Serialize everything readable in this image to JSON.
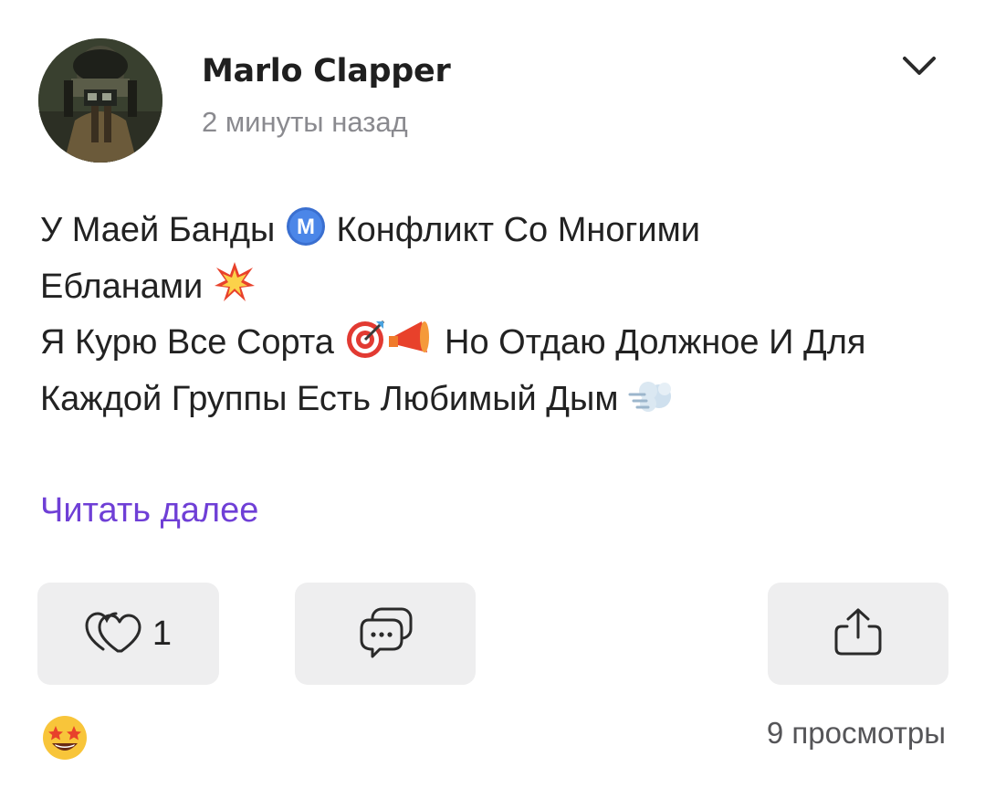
{
  "post": {
    "author": "Marlo Clapper",
    "time": "2 минуты назад",
    "lines": [
      {
        "text": "У Маей Банды ",
        "emoji": "m-badge-icon",
        "after": " Конфликт Со Многими"
      },
      {
        "text": "Ебланами ",
        "emoji": "collision-icon",
        "after": ""
      },
      {
        "text": "Я Курю Все Сорта ",
        "emoji": "target-megaphone-icon",
        "after": " Но Отдаю Должное И Для"
      },
      {
        "text": "Каждой Группы Есть Любимый Дым ",
        "emoji": "dash-icon",
        "after": ""
      }
    ],
    "read_more": "Читать далее",
    "like_count": "1",
    "views": "9 просмотры"
  },
  "colors": {
    "accent": "#6f3fd6",
    "button_bg": "#eeeeef",
    "secondary_text": "#8a8a8f"
  }
}
